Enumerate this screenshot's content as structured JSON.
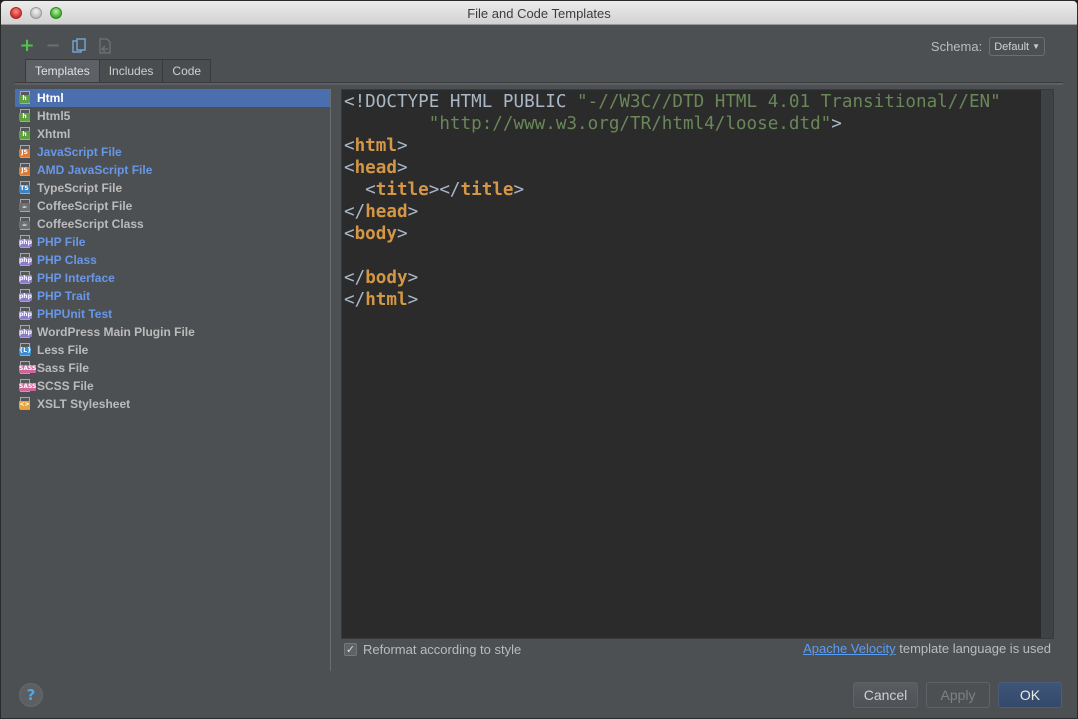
{
  "window": {
    "title": "File and Code Templates"
  },
  "toolbar": {
    "icons": [
      "add-icon",
      "remove-icon",
      "copy-icon",
      "reset-icon"
    ]
  },
  "schema": {
    "label": "Schema:",
    "value": "Default"
  },
  "tabs": [
    {
      "label": "Templates",
      "active": true
    },
    {
      "label": "Includes",
      "active": false
    },
    {
      "label": "Code",
      "active": false
    }
  ],
  "templates": [
    {
      "label": "Html",
      "icon": "html-file-icon",
      "badge": "h",
      "badge_color": "#5fa043",
      "style": "normal",
      "selected": true
    },
    {
      "label": "Html5",
      "icon": "html-file-icon",
      "badge": "h",
      "badge_color": "#5fa043",
      "style": "normal"
    },
    {
      "label": "Xhtml",
      "icon": "xhtml-file-icon",
      "badge": "h",
      "badge_color": "#5fa043",
      "style": "normal"
    },
    {
      "label": "JavaScript File",
      "icon": "javascript-file-icon",
      "badge": "JS",
      "badge_color": "#d97b34",
      "style": "blue"
    },
    {
      "label": "AMD JavaScript File",
      "icon": "javascript-file-icon",
      "badge": "JS",
      "badge_color": "#d97b34",
      "style": "blue"
    },
    {
      "label": "TypeScript File",
      "icon": "typescript-file-icon",
      "badge": "TS",
      "badge_color": "#3a84c6",
      "style": "normal"
    },
    {
      "label": "CoffeeScript File",
      "icon": "coffeescript-file-icon",
      "badge": "☕",
      "badge_color": "#6e6e6e",
      "style": "normal"
    },
    {
      "label": "CoffeeScript Class",
      "icon": "coffeescript-file-icon",
      "badge": "☕",
      "badge_color": "#6e6e6e",
      "style": "normal"
    },
    {
      "label": "PHP File",
      "icon": "php-file-icon",
      "badge": "php",
      "badge_color": "#8c7cc9",
      "style": "blue"
    },
    {
      "label": "PHP Class",
      "icon": "php-file-icon",
      "badge": "php",
      "badge_color": "#8c7cc9",
      "style": "blue"
    },
    {
      "label": "PHP Interface",
      "icon": "php-file-icon",
      "badge": "php",
      "badge_color": "#8c7cc9",
      "style": "blue"
    },
    {
      "label": "PHP Trait",
      "icon": "php-file-icon",
      "badge": "php",
      "badge_color": "#8c7cc9",
      "style": "blue"
    },
    {
      "label": "PHPUnit Test",
      "icon": "php-file-icon",
      "badge": "php",
      "badge_color": "#8c7cc9",
      "style": "blue"
    },
    {
      "label": "WordPress Main Plugin File",
      "icon": "php-file-icon",
      "badge": "php",
      "badge_color": "#8c7cc9",
      "style": "normal"
    },
    {
      "label": "Less File",
      "icon": "less-file-icon",
      "badge": "{L}",
      "badge_color": "#3a8ed0",
      "style": "normal"
    },
    {
      "label": "Sass File",
      "icon": "sass-file-icon",
      "badge": "SASS",
      "badge_color": "#cf649a",
      "style": "normal"
    },
    {
      "label": "SCSS File",
      "icon": "scss-file-icon",
      "badge": "SASS",
      "badge_color": "#cf649a",
      "style": "normal"
    },
    {
      "label": "XSLT Stylesheet",
      "icon": "xslt-file-icon",
      "badge": "<>",
      "badge_color": "#e8a33c",
      "style": "normal"
    }
  ],
  "editor": {
    "lines": [
      [
        {
          "t": "<!DOCTYPE HTML PUBLIC ",
          "c": "doc"
        },
        {
          "t": "\"-//W3C//DTD HTML 4.01 Transitional//EN\"",
          "c": "str"
        }
      ],
      [
        {
          "t": "        ",
          "c": "doc"
        },
        {
          "t": "\"http://www.w3.org/TR/html4/loose.dtd\"",
          "c": "str"
        },
        {
          "t": ">",
          "c": "br"
        }
      ],
      [
        {
          "t": "<",
          "c": "br"
        },
        {
          "t": "html",
          "c": "tag"
        },
        {
          "t": ">",
          "c": "br"
        }
      ],
      [
        {
          "t": "<",
          "c": "br"
        },
        {
          "t": "head",
          "c": "tag"
        },
        {
          "t": ">",
          "c": "br"
        }
      ],
      [
        {
          "t": "  <",
          "c": "br"
        },
        {
          "t": "title",
          "c": "tag"
        },
        {
          "t": "></",
          "c": "br"
        },
        {
          "t": "title",
          "c": "tag"
        },
        {
          "t": ">",
          "c": "br"
        }
      ],
      [
        {
          "t": "</",
          "c": "br"
        },
        {
          "t": "head",
          "c": "tag"
        },
        {
          "t": ">",
          "c": "br"
        }
      ],
      [
        {
          "t": "<",
          "c": "br"
        },
        {
          "t": "body",
          "c": "tag"
        },
        {
          "t": ">",
          "c": "br"
        }
      ],
      [],
      [
        {
          "t": "</",
          "c": "br"
        },
        {
          "t": "body",
          "c": "tag"
        },
        {
          "t": ">",
          "c": "br"
        }
      ],
      [
        {
          "t": "</",
          "c": "br"
        },
        {
          "t": "html",
          "c": "tag"
        },
        {
          "t": ">",
          "c": "br"
        }
      ]
    ]
  },
  "options": {
    "reformat_label": "Reformat according to style",
    "reformat_checked": true,
    "velocity_link": "Apache Velocity",
    "velocity_suffix": " template language is used"
  },
  "buttons": {
    "help": "?",
    "cancel": "Cancel",
    "apply": "Apply",
    "ok": "OK"
  }
}
